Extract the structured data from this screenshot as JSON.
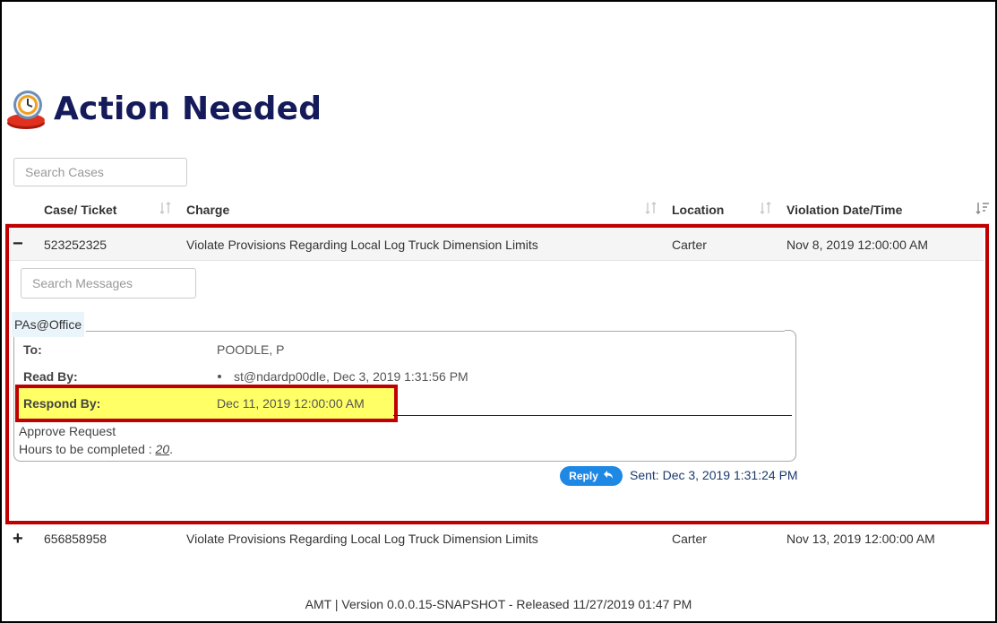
{
  "page": {
    "title": "Action Needed"
  },
  "search_cases": {
    "placeholder": "Search Cases",
    "value": ""
  },
  "table": {
    "columns": [
      {
        "label": "Case/ Ticket"
      },
      {
        "label": "Charge"
      },
      {
        "label": "Location"
      },
      {
        "label": "Violation Date/Time"
      }
    ],
    "rows": [
      {
        "toggle": "−",
        "case": "523252325",
        "charge": "Violate Provisions Regarding Local Log Truck Dimension Limits",
        "location": "Carter",
        "violation_datetime": "Nov 8, 2019 12:00:00 AM",
        "expanded": true
      },
      {
        "toggle": "+",
        "case": "656858958",
        "charge": "Violate Provisions Regarding Local Log Truck Dimension Limits",
        "location": "Carter",
        "violation_datetime": "Nov 13, 2019 12:00:00 AM",
        "expanded": false
      }
    ]
  },
  "messages": {
    "search_placeholder": "Search Messages",
    "items": [
      {
        "sender": "PAs@Office",
        "to_label": "To:",
        "to_value": "POODLE, P",
        "read_by_label": "Read By:",
        "read_by_value": "st@ndardp00dle, Dec 3, 2019 1:31:56 PM",
        "respond_by_label": "Respond By:",
        "respond_by_value": "Dec 11, 2019 12:00:00 AM",
        "body_line1": "Approve Request",
        "body_line2_prefix": "Hours to be completed : ",
        "body_hours": "20",
        "body_line2_suffix": ".",
        "reply_label": "Reply",
        "sent": "Sent: Dec 3, 2019 1:31:24 PM"
      }
    ]
  },
  "footer": {
    "text": "AMT | Version 0.0.0.15-SNAPSHOT - Released 11/27/2019 01:47 PM"
  },
  "colors": {
    "title": "#141a5a",
    "highlight_border": "#c00000",
    "highlight_fill": "#ffff66",
    "reply_button": "#1e88e5"
  },
  "icons": {
    "logo": "clock-icon",
    "sort": "sort-icon",
    "sort_active": "sort-desc-icon",
    "reply": "reply-arrow-icon"
  }
}
